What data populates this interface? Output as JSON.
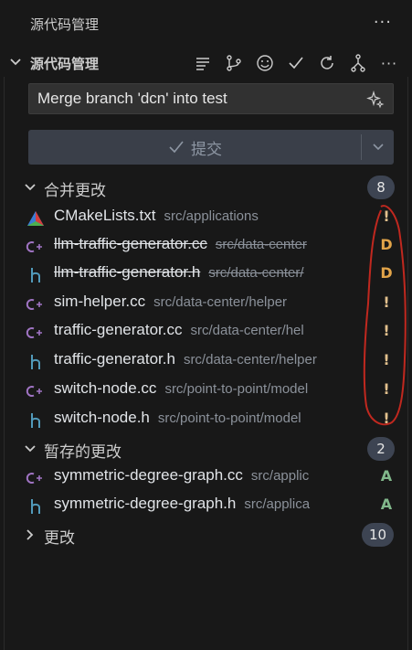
{
  "window": {
    "title": "源代码管理",
    "more_label": "···"
  },
  "section": {
    "label": "源代码管理",
    "more_label": "···"
  },
  "toolbar": [
    "list-icon",
    "graph-icon",
    "smiley-icon",
    "check-icon",
    "refresh-icon",
    "branch-icon",
    "more-icon"
  ],
  "commit": {
    "message": "Merge branch 'dcn' into test",
    "button_label": "提交"
  },
  "groups": {
    "merge": {
      "label": "合并更改",
      "count": "8"
    },
    "staged": {
      "label": "暂存的更改",
      "count": "2"
    },
    "changes": {
      "label": "更改",
      "count": "10"
    }
  },
  "files": [
    {
      "name": "CMakeLists.txt",
      "path": "src/applications",
      "status": "!",
      "type": "cmake"
    },
    {
      "name": "llm-traffic-generator.cc",
      "path": "src/data-center",
      "status": "D",
      "type": "cc"
    },
    {
      "name": "llm-traffic-generator.h",
      "path": "src/data-center/",
      "status": "D",
      "type": "h"
    },
    {
      "name": "sim-helper.cc",
      "path": "src/data-center/helper",
      "status": "!",
      "type": "cc"
    },
    {
      "name": "traffic-generator.cc",
      "path": "src/data-center/hel",
      "status": "!",
      "type": "cc"
    },
    {
      "name": "traffic-generator.h",
      "path": "src/data-center/helper",
      "status": "!",
      "type": "h"
    },
    {
      "name": "switch-node.cc",
      "path": "src/point-to-point/model",
      "status": "!",
      "type": "cc"
    },
    {
      "name": "switch-node.h",
      "path": "src/point-to-point/model",
      "status": "!",
      "type": "h"
    },
    {
      "name": "symmetric-degree-graph.cc",
      "path": "src/applic",
      "status": "A",
      "type": "cc"
    },
    {
      "name": "symmetric-degree-graph.h",
      "path": "src/applica",
      "status": "A",
      "type": "h"
    }
  ],
  "colors": {
    "modified": "#e2c08d",
    "deleted": "#e2a449",
    "added": "#81b88b",
    "cc_icon": "#a074c4",
    "h_icon": "#519aba",
    "annotation": "#c0281f"
  }
}
